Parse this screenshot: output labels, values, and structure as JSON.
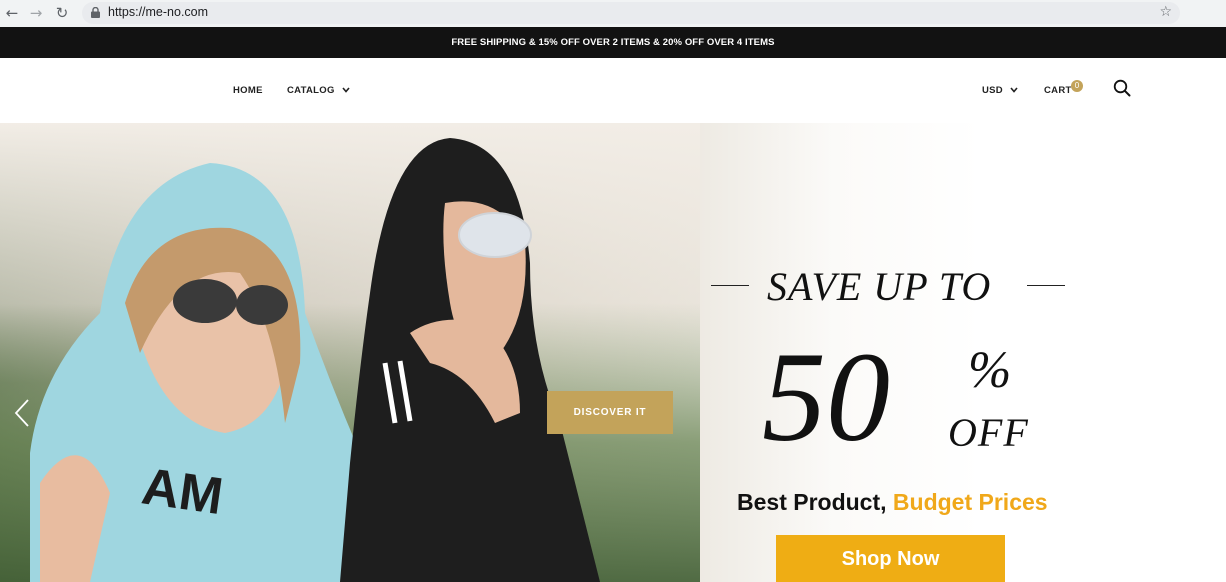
{
  "browser": {
    "url": "https://me-no.com"
  },
  "promo": {
    "text": "FREE SHIPPING & 15% OFF OVER 2 ITEMS & 20% OFF OVER 4 ITEMS"
  },
  "nav": {
    "home": "HOME",
    "catalog": "CATALOG",
    "currency": "USD",
    "cart": "CART",
    "cart_count": "0"
  },
  "hero": {
    "discover_label": "DISCOVER IT",
    "save_text": "SAVE UP TO",
    "fifty": "50",
    "percent": "%",
    "off": "OFF",
    "tagline_main": "Best Product,",
    "tagline_highlight": "Budget Prices",
    "shop_label": "Shop Now"
  },
  "colors": {
    "gold": "#c3a35a",
    "orange": "#efad14",
    "dark": "#121212"
  }
}
